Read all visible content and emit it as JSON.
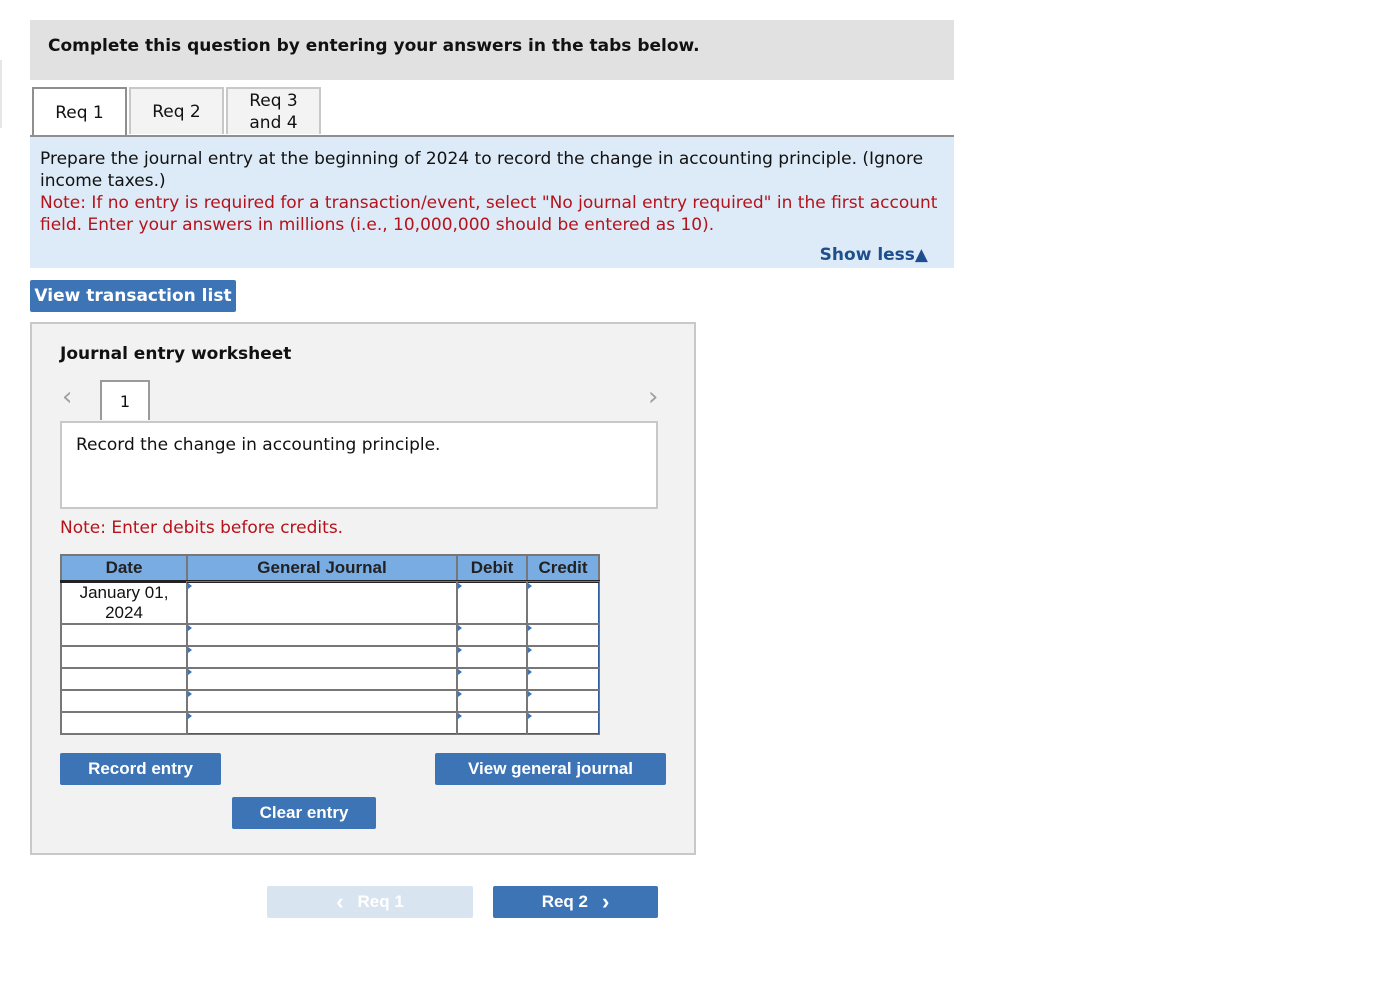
{
  "instructions": "Complete this question by entering your answers in the tabs below.",
  "tabs": [
    {
      "label": "Req 1",
      "active": true
    },
    {
      "label": "Req 2",
      "active": false
    },
    {
      "label": "Req 3\nand 4",
      "line1": "Req 3",
      "line2": "and 4",
      "active": false
    }
  ],
  "prompt": {
    "text": "Prepare the journal entry at the beginning of 2024 to record the change in accounting principle. (Ignore income taxes.)",
    "note": "Note: If no entry is required for a transaction/event, select \"No journal entry required\" in the first account field. Enter your answers in millions (i.e., 10,000,000 should be entered as 10).",
    "show_less": "Show less▲"
  },
  "view_transaction_list": "View transaction list",
  "worksheet": {
    "title": "Journal entry worksheet",
    "page": "1",
    "description": "Record the change in accounting principle.",
    "note": "Note: Enter debits before credits.",
    "columns": [
      "Date",
      "General Journal",
      "Debit",
      "Credit"
    ],
    "rows": [
      {
        "date": "January 01, 2024",
        "date_line1": "January 01,",
        "date_line2": "2024",
        "account": "",
        "debit": "",
        "credit": ""
      },
      {
        "date": "",
        "account": "",
        "debit": "",
        "credit": ""
      },
      {
        "date": "",
        "account": "",
        "debit": "",
        "credit": ""
      },
      {
        "date": "",
        "account": "",
        "debit": "",
        "credit": ""
      },
      {
        "date": "",
        "account": "",
        "debit": "",
        "credit": ""
      },
      {
        "date": "",
        "account": "",
        "debit": "",
        "credit": ""
      }
    ],
    "buttons": {
      "record": "Record entry",
      "clear": "Clear entry",
      "view_journal": "View general journal"
    }
  },
  "navigation": {
    "prev": "Req 1",
    "next": "Req 2"
  },
  "colors": {
    "accent": "#3d74b5",
    "note_red": "#b5121b",
    "prompt_bg": "#dcebf7",
    "header_blue": "#79ace3"
  }
}
